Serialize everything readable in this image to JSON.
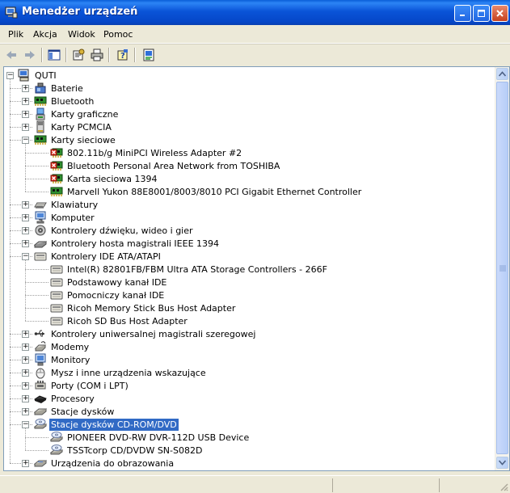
{
  "window": {
    "title": "Menedżer urządzeń"
  },
  "menu": [
    {
      "label": "Plik"
    },
    {
      "label": "Akcja"
    },
    {
      "label": "Widok"
    },
    {
      "label": "Pomoc"
    }
  ],
  "tree": [
    {
      "label": "QUTI",
      "icon": "computer-icon",
      "level": 0,
      "expand": "minus"
    },
    {
      "label": "Baterie",
      "icon": "battery-icon",
      "level": 1,
      "expand": "plus"
    },
    {
      "label": "Bluetooth",
      "icon": "network-card-icon",
      "level": 1,
      "expand": "plus"
    },
    {
      "label": "Karty graficzne",
      "icon": "display-adapter-icon",
      "level": 1,
      "expand": "plus"
    },
    {
      "label": "Karty PCMCIA",
      "icon": "pcmcia-icon",
      "level": 1,
      "expand": "plus"
    },
    {
      "label": "Karty sieciowe",
      "icon": "network-card-icon",
      "level": 1,
      "expand": "minus"
    },
    {
      "label": "802.11b/g MiniPCI Wireless Adapter #2",
      "icon": "network-card-warning-icon",
      "level": 2
    },
    {
      "label": "Bluetooth Personal Area Network from TOSHIBA",
      "icon": "network-card-warning-icon",
      "level": 2
    },
    {
      "label": "Karta sieciowa 1394",
      "icon": "network-card-warning-icon",
      "level": 2
    },
    {
      "label": "Marvell Yukon 88E8001/8003/8010 PCI Gigabit Ethernet Controller",
      "icon": "network-card-icon",
      "level": 2
    },
    {
      "label": "Klawiatury",
      "icon": "keyboard-icon",
      "level": 1,
      "expand": "plus"
    },
    {
      "label": "Komputer",
      "icon": "computer-monitor-icon",
      "level": 1,
      "expand": "plus"
    },
    {
      "label": "Kontrolery dźwięku, wideo i gier",
      "icon": "sound-icon",
      "level": 1,
      "expand": "plus"
    },
    {
      "label": "Kontrolery hosta magistrali IEEE 1394",
      "icon": "ieee1394-icon",
      "level": 1,
      "expand": "plus"
    },
    {
      "label": "Kontrolery IDE ATA/ATAPI",
      "icon": "ide-controller-icon",
      "level": 1,
      "expand": "minus"
    },
    {
      "label": "Intel(R) 82801FB/FBM Ultra ATA Storage Controllers - 266F",
      "icon": "ide-controller-icon",
      "level": 2
    },
    {
      "label": "Podstawowy kanał IDE",
      "icon": "ide-controller-icon",
      "level": 2
    },
    {
      "label": "Pomocniczy kanał IDE",
      "icon": "ide-controller-icon",
      "level": 2
    },
    {
      "label": "Ricoh Memory Stick Bus Host Adapter",
      "icon": "ide-controller-icon",
      "level": 2
    },
    {
      "label": "Ricoh SD Bus Host Adapter",
      "icon": "ide-controller-icon",
      "level": 2
    },
    {
      "label": "Kontrolery uniwersalnej magistrali szeregowej",
      "icon": "usb-icon",
      "level": 1,
      "expand": "plus"
    },
    {
      "label": "Modemy",
      "icon": "modem-icon",
      "level": 1,
      "expand": "plus"
    },
    {
      "label": "Monitory",
      "icon": "monitor-icon",
      "level": 1,
      "expand": "plus"
    },
    {
      "label": "Mysz i inne urządzenia wskazujące",
      "icon": "mouse-icon",
      "level": 1,
      "expand": "plus"
    },
    {
      "label": "Porty (COM i LPT)",
      "icon": "port-icon",
      "level": 1,
      "expand": "plus"
    },
    {
      "label": "Procesory",
      "icon": "processor-icon",
      "level": 1,
      "expand": "plus"
    },
    {
      "label": "Stacje dysków",
      "icon": "disk-drive-icon",
      "level": 1,
      "expand": "plus"
    },
    {
      "label": "Stacje dysków CD-ROM/DVD",
      "icon": "cdrom-icon",
      "level": 1,
      "expand": "minus",
      "selected": true
    },
    {
      "label": "PIONEER DVD-RW  DVR-112D USB Device",
      "icon": "cdrom-icon",
      "level": 2
    },
    {
      "label": "TSSTcorp CD/DVDW SN-S082D",
      "icon": "cdrom-icon",
      "level": 2
    },
    {
      "label": "Urządzenia do obrazowania",
      "icon": "imaging-icon",
      "level": 1,
      "expand": "plus"
    }
  ],
  "colors": {
    "selection": "#316AC5",
    "titlebar": "#0A54D8"
  }
}
